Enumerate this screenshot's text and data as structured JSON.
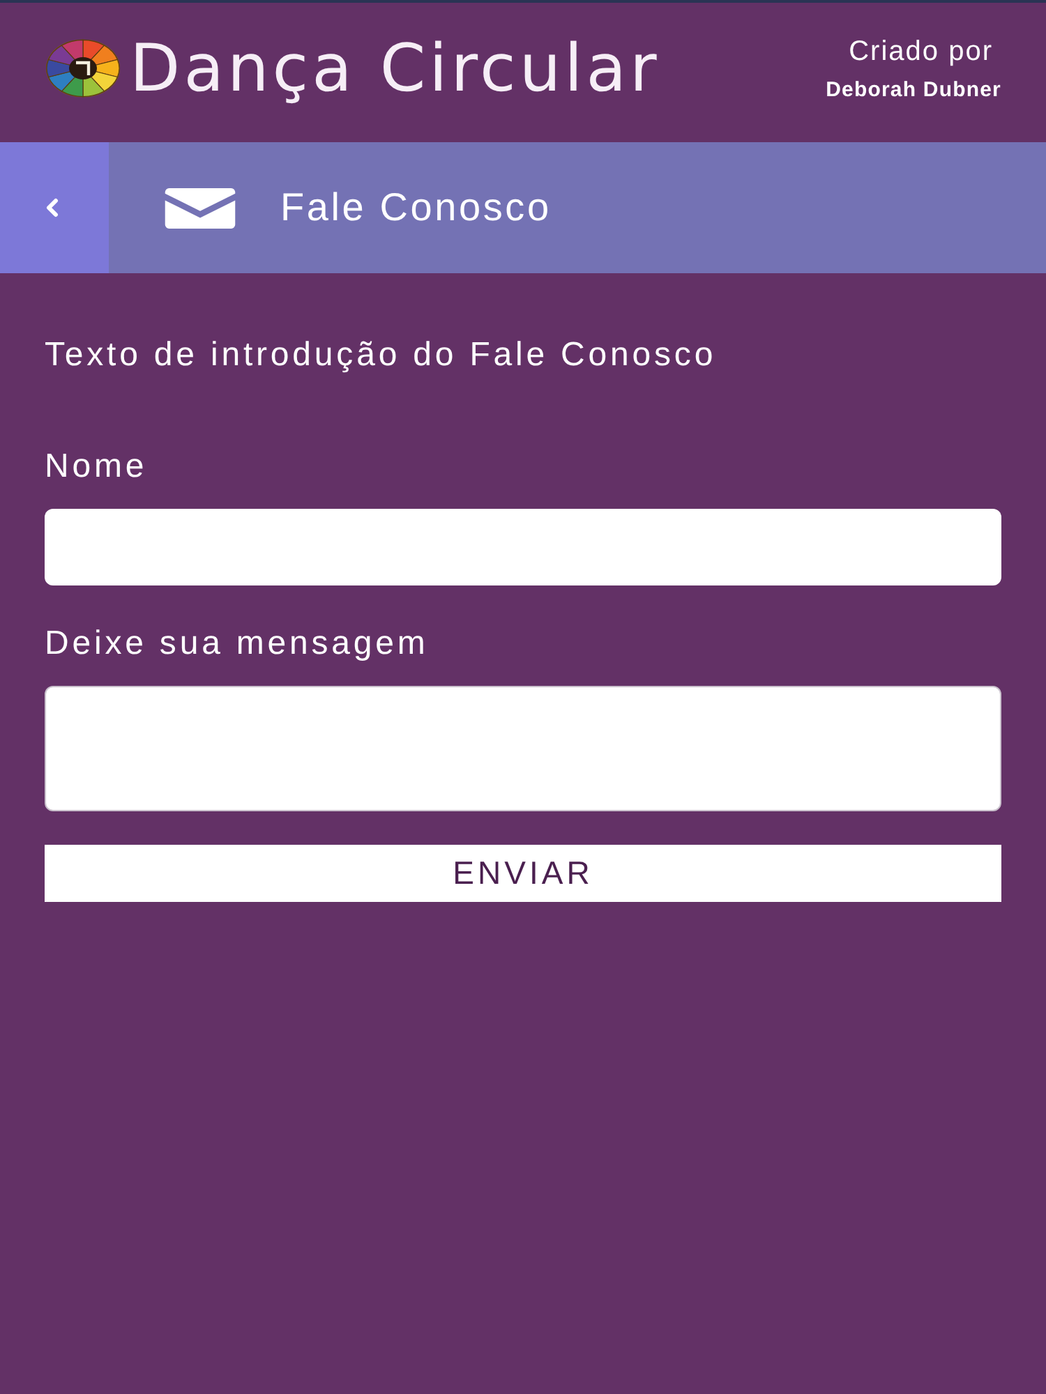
{
  "header": {
    "title": "Dança Circular",
    "credit_label": "Criado por",
    "credit_name": "Deborah Dubner"
  },
  "nav": {
    "title": "Fale Conosco"
  },
  "intro": "Texto de introdução do Fale Conosco",
  "form": {
    "fields": [
      {
        "kind": "input",
        "label": "Nome"
      },
      {
        "kind": "textarea",
        "label": "Deixe sua mensagem"
      }
    ],
    "submit": "ENVIAR"
  }
}
